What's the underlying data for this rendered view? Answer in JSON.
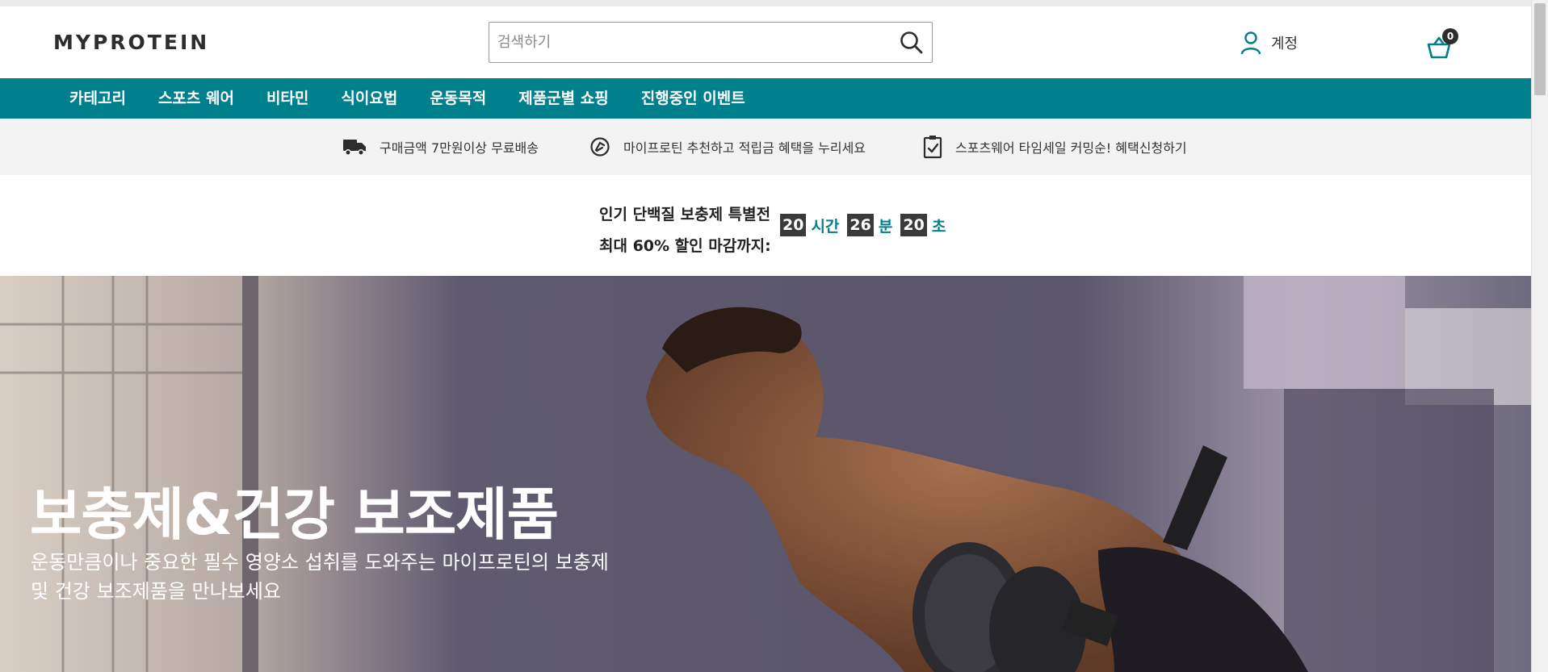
{
  "brand": {
    "logo_text": "MYPROTEIN",
    "accent": "#007f8c"
  },
  "header": {
    "search_placeholder": "검색하기",
    "account_label": "계정",
    "basket_count": "0"
  },
  "nav": {
    "items": [
      {
        "label": "카테고리"
      },
      {
        "label": "스포츠 웨어"
      },
      {
        "label": "비타민"
      },
      {
        "label": "식이요법"
      },
      {
        "label": "운동목적"
      },
      {
        "label": "제품군별 쇼핑"
      },
      {
        "label": "진행중인 이벤트"
      }
    ]
  },
  "benefits": [
    {
      "icon": "truck-icon",
      "text": "구매금액 7만원이상 무료배송"
    },
    {
      "icon": "coin-icon",
      "text": "마이프로틴 추천하고 적립금 혜택을 누리세요"
    },
    {
      "icon": "clipboard-check-icon",
      "text": "스포츠웨어 타임세일 커밍순! 혜택신청하기"
    }
  ],
  "countdown": {
    "line1": "인기 단백질 보충제 특별전",
    "line2": "최대 60% 할인 마감까지:",
    "hours": "20",
    "hours_unit": "시간",
    "minutes": "26",
    "minutes_unit": "분",
    "seconds": "20",
    "seconds_unit": "초"
  },
  "hero": {
    "title": "보충제&건강 보조제품",
    "subtitle_line1": "운동만큼이나 중요한 필수 영양소 섭취를 도와주는 마이프로틴의 보충제",
    "subtitle_line2": "및 건강 보조제품을 만나보세요"
  }
}
